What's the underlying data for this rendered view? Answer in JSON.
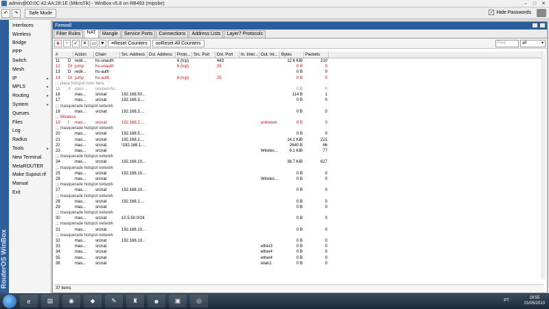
{
  "window": {
    "title": "admin@00:0C:42:AA:28:1E (MikroTik) - WinBox v5.8 on RB493 (mipsbe)"
  },
  "toolbar": {
    "safe_mode": "Safe Mode",
    "hide_passwords": "Hide Passwords"
  },
  "sidebar": {
    "brand": "RouterOS WinBox",
    "items": [
      {
        "label": "Interfaces",
        "arrow": ""
      },
      {
        "label": "Wireless",
        "arrow": ""
      },
      {
        "label": "Bridge",
        "arrow": ""
      },
      {
        "label": "PPP",
        "arrow": ""
      },
      {
        "label": "Switch",
        "arrow": ""
      },
      {
        "label": "Mesh",
        "arrow": ""
      },
      {
        "label": "IP",
        "arrow": "▸"
      },
      {
        "label": "MPLS",
        "arrow": "▸"
      },
      {
        "label": "Routing",
        "arrow": "▸"
      },
      {
        "label": "System",
        "arrow": "▸"
      },
      {
        "label": "Queues",
        "arrow": ""
      },
      {
        "label": "Files",
        "arrow": ""
      },
      {
        "label": "Log",
        "arrow": ""
      },
      {
        "label": "Radius",
        "arrow": ""
      },
      {
        "label": "Tools",
        "arrow": "▸"
      },
      {
        "label": "New Terminal",
        "arrow": ""
      },
      {
        "label": "MetaROUTER",
        "arrow": ""
      },
      {
        "label": "Make Supout.rif",
        "arrow": ""
      },
      {
        "label": "Manual",
        "arrow": ""
      },
      {
        "label": "Exit",
        "arrow": ""
      }
    ]
  },
  "firewall": {
    "title": "Firewall",
    "tabs": [
      "Filter Rules",
      "NAT",
      "Mangle",
      "Service Ports",
      "Connections",
      "Address Lists",
      "Layer7 Protocols"
    ],
    "active_tab": "NAT",
    "reset_counters": "Reset Counters",
    "reset_all_counters": "Reset All Counters",
    "find_placeholder": "Find",
    "filter_value": "all",
    "columns": [
      "#",
      "Action",
      "Chain",
      "Src. Address",
      "Dst. Address",
      "Proto...",
      "Src. Port",
      "Dst. Port",
      "In. Inter...",
      "Out. Int...",
      "Bytes",
      "Packets"
    ],
    "status": "37 items"
  },
  "rows": [
    {
      "type": "rule",
      "num": "11",
      "flag": "D",
      "action": "redir...",
      "chain": "hs-unauth",
      "src": "",
      "dst": "",
      "proto": "6 (tcp)",
      "sport": "",
      "dport": "443",
      "in": "",
      "out": "",
      "bytes": "12.6 KiB",
      "packets": "210",
      "style": ""
    },
    {
      "type": "rule",
      "num": "12",
      "flag": "DI",
      "action": "jump",
      "chain": "hs-unauth",
      "src": "",
      "dst": "",
      "proto": "6 (tcp)",
      "sport": "",
      "dport": "25",
      "in": "",
      "out": "",
      "bytes": "0 B",
      "packets": "0",
      "style": "red"
    },
    {
      "type": "rule",
      "num": "13",
      "flag": "D",
      "action": "redir...",
      "chain": "hs-auth",
      "src": "",
      "dst": "",
      "proto": "",
      "sport": "",
      "dport": "",
      "in": "",
      "out": "",
      "bytes": "0 B",
      "packets": "0",
      "style": ""
    },
    {
      "type": "rule",
      "num": "14",
      "flag": "DI",
      "action": "jump",
      "chain": "hs-auth",
      "src": "",
      "dst": "",
      "proto": "6 (tcp)",
      "sport": "",
      "dport": "25",
      "in": "",
      "out": "",
      "bytes": "0 B",
      "packets": "0",
      "style": "red"
    },
    {
      "type": "comment",
      "text": ";;; place hotspot rules here",
      "style": "gray"
    },
    {
      "type": "rule",
      "num": "15",
      "flag": "X",
      "action": "pass...",
      "chain": "unused-hs...",
      "src": "",
      "dst": "",
      "proto": "",
      "sport": "",
      "dport": "",
      "in": "",
      "out": "",
      "bytes": "0 B",
      "packets": "0",
      "style": "gray"
    },
    {
      "type": "rule",
      "num": "16",
      "flag": "",
      "action": "mas...",
      "chain": "srcnat",
      "src": "192.168.50...",
      "dst": "",
      "proto": "",
      "sport": "",
      "dport": "",
      "in": "",
      "out": "",
      "bytes": "114 B",
      "packets": "1",
      "style": ""
    },
    {
      "type": "rule",
      "num": "17",
      "flag": "",
      "action": "mas...",
      "chain": "srcnat",
      "src": "192.168.3....",
      "dst": "",
      "proto": "",
      "sport": "",
      "dport": "",
      "in": "",
      "out": "",
      "bytes": "0 B",
      "packets": "0",
      "style": ""
    },
    {
      "type": "comment",
      "text": ";;; masquerade hotspot network",
      "style": ""
    },
    {
      "type": "rule",
      "num": "18",
      "flag": "",
      "action": "mas...",
      "chain": "srcnat",
      "src": "192.168.3....",
      "dst": "",
      "proto": "",
      "sport": "",
      "dport": "",
      "in": "",
      "out": "",
      "bytes": "0 B",
      "packets": "0",
      "style": ""
    },
    {
      "type": "comment",
      "text": ";;; Wireless",
      "style": "red"
    },
    {
      "type": "rule",
      "num": "19",
      "flag": "I",
      "action": "mas...",
      "chain": "srcnat",
      "src": "192.168.2....",
      "dst": "",
      "proto": "",
      "sport": "",
      "dport": "",
      "in": "",
      "out": "unknown",
      "bytes": "0 B",
      "packets": "0",
      "style": "red"
    },
    {
      "type": "comment",
      "text": ";;; masquerade hotspot network",
      "style": ""
    },
    {
      "type": "rule",
      "num": "20",
      "flag": "",
      "action": "mas...",
      "chain": "srcnat",
      "src": "192.168.5....",
      "dst": "",
      "proto": "",
      "sport": "",
      "dport": "",
      "in": "",
      "out": "",
      "bytes": "0 B",
      "packets": "0",
      "style": ""
    },
    {
      "type": "rule",
      "num": "21",
      "flag": "",
      "action": "mas...",
      "chain": "srcnat",
      "src": "192.168.1....",
      "dst": "",
      "proto": "",
      "sport": "",
      "dport": "",
      "in": "",
      "out": "",
      "bytes": "14.1 KiB",
      "packets": "221",
      "style": ""
    },
    {
      "type": "rule",
      "num": "22",
      "flag": "",
      "action": "mas...",
      "chain": "srcnat",
      "src": "!192.168.1....",
      "dst": "",
      "proto": "",
      "sport": "",
      "dport": "",
      "in": "",
      "out": "",
      "bytes": "2640 B",
      "packets": "66",
      "style": ""
    },
    {
      "type": "rule",
      "num": "23",
      "flag": "",
      "action": "mas...",
      "chain": "srcnat",
      "src": "",
      "dst": "",
      "proto": "",
      "sport": "",
      "dport": "",
      "in": "",
      "out": "Wireles...",
      "bytes": "9.1 KiB",
      "packets": "77",
      "style": ""
    },
    {
      "type": "comment",
      "text": ";;; masquerade hotspot network",
      "style": ""
    },
    {
      "type": "rule",
      "num": "24",
      "flag": "",
      "action": "mas...",
      "chain": "srcnat",
      "src": "192.168.10...",
      "dst": "",
      "proto": "",
      "sport": "",
      "dport": "",
      "in": "",
      "out": "",
      "bytes": "36.7 KiB",
      "packets": "627",
      "style": ""
    },
    {
      "type": "comment",
      "text": ";;; masquerade hotspot network",
      "style": ""
    },
    {
      "type": "rule",
      "num": "25",
      "flag": "",
      "action": "mas...",
      "chain": "srcnat",
      "src": "192.168.10...",
      "dst": "",
      "proto": "",
      "sport": "",
      "dport": "",
      "in": "",
      "out": "",
      "bytes": "0 B",
      "packets": "0",
      "style": ""
    },
    {
      "type": "rule",
      "num": "26",
      "flag": "",
      "action": "mas...",
      "chain": "srcnat",
      "src": "",
      "dst": "",
      "proto": "",
      "sport": "",
      "dport": "",
      "in": "",
      "out": "Wireles...",
      "bytes": "0 B",
      "packets": "0",
      "style": ""
    },
    {
      "type": "comment",
      "text": ";;; masquerade hotspot network",
      "style": ""
    },
    {
      "type": "rule",
      "num": "27",
      "flag": "",
      "action": "mas...",
      "chain": "srcnat",
      "src": "192.168.10...",
      "dst": "",
      "proto": "",
      "sport": "",
      "dport": "",
      "in": "",
      "out": "",
      "bytes": "0 B",
      "packets": "0",
      "style": ""
    },
    {
      "type": "comment",
      "text": ";;; masquerade hotspot network",
      "style": ""
    },
    {
      "type": "rule",
      "num": "28",
      "flag": "",
      "action": "mas...",
      "chain": "srcnat",
      "src": "192.168.1....",
      "dst": "",
      "proto": "",
      "sport": "",
      "dport": "",
      "in": "",
      "out": "",
      "bytes": "0 B",
      "packets": "0",
      "style": ""
    },
    {
      "type": "rule",
      "num": "29",
      "flag": "",
      "action": "mas...",
      "chain": "srcnat",
      "src": "",
      "dst": "",
      "proto": "",
      "sport": "",
      "dport": "",
      "in": "",
      "out": "",
      "bytes": "0 B",
      "packets": "0",
      "style": ""
    },
    {
      "type": "comment",
      "text": ";;; masquerade hotspot network",
      "style": ""
    },
    {
      "type": "rule",
      "num": "30",
      "flag": "",
      "action": "mas...",
      "chain": "srcnat",
      "src": "10.5.50.0/24",
      "dst": "",
      "proto": "",
      "sport": "",
      "dport": "",
      "in": "",
      "out": "",
      "bytes": "0 B",
      "packets": "0",
      "style": ""
    },
    {
      "type": "comment",
      "text": ";;; masquerade hotspot network",
      "style": ""
    },
    {
      "type": "rule",
      "num": "31",
      "flag": "",
      "action": "mas...",
      "chain": "srcnat",
      "src": "192.168.10...",
      "dst": "",
      "proto": "",
      "sport": "",
      "dport": "",
      "in": "",
      "out": "",
      "bytes": "0 B",
      "packets": "0",
      "style": ""
    },
    {
      "type": "comment",
      "text": ";;; masquerade hotspot network",
      "style": ""
    },
    {
      "type": "rule",
      "num": "32",
      "flag": "",
      "action": "mas...",
      "chain": "srcnat",
      "src": "192.168.10...",
      "dst": "",
      "proto": "",
      "sport": "",
      "dport": "",
      "in": "",
      "out": "",
      "bytes": "0 B",
      "packets": "0",
      "style": ""
    },
    {
      "type": "rule",
      "num": "33",
      "flag": "",
      "action": "mas...",
      "chain": "srcnat",
      "src": "",
      "dst": "",
      "proto": "",
      "sport": "",
      "dport": "",
      "in": "",
      "out": "ether3",
      "bytes": "0 B",
      "packets": "0",
      "style": ""
    },
    {
      "type": "rule",
      "num": "34",
      "flag": "",
      "action": "mas...",
      "chain": "srcnat",
      "src": "",
      "dst": "",
      "proto": "",
      "sport": "",
      "dport": "",
      "in": "",
      "out": "ether4",
      "bytes": "0 B",
      "packets": "0",
      "style": ""
    },
    {
      "type": "rule",
      "num": "35",
      "flag": "",
      "action": "mas...",
      "chain": "srcnat",
      "src": "",
      "dst": "",
      "proto": "",
      "sport": "",
      "dport": "",
      "in": "",
      "out": "ether4",
      "bytes": "0 B",
      "packets": "0",
      "style": ""
    },
    {
      "type": "rule",
      "num": "36",
      "flag": "",
      "action": "mas...",
      "chain": "srcnat",
      "src": "",
      "dst": "",
      "proto": "",
      "sport": "",
      "dport": "",
      "in": "",
      "out": "wlan1",
      "bytes": "0 B",
      "packets": "0",
      "style": ""
    }
  ],
  "taskbar": {
    "lang": "PT",
    "time": "18:55",
    "date": "01/05/2013"
  }
}
